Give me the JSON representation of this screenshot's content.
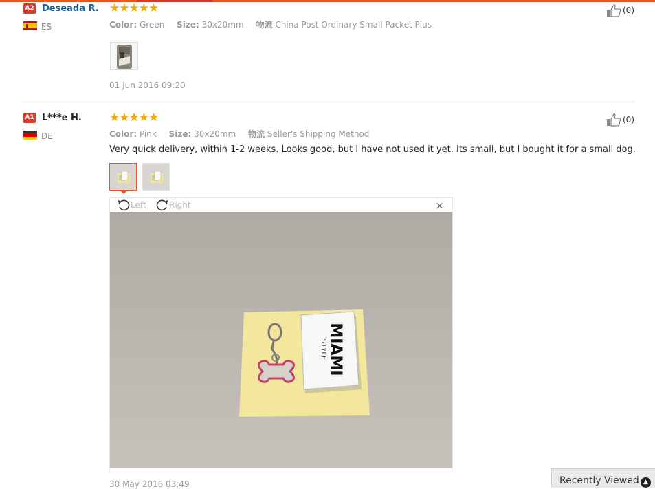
{
  "reviews": [
    {
      "rank_badge": "A2",
      "username": "Deseada R.",
      "country": "ES",
      "stars": "★★★★★",
      "color_label": "Color:",
      "color_value": "Green",
      "size_label": "Size:",
      "size_value": "30x20mm",
      "shipping_label": "物流",
      "shipping_value": "China Post Ordinary Small Packet Plus",
      "helpful_count": "(0)",
      "date": "01 Jun 2016 09:20"
    },
    {
      "rank_badge": "A1",
      "username": "L***e H.",
      "country": "DE",
      "stars": "★★★★★",
      "color_label": "Color:",
      "color_value": "Pink",
      "size_label": "Size:",
      "size_value": "30x20mm",
      "shipping_label": "物流",
      "shipping_value": "Seller's Shipping Method",
      "text": "Very quick delivery, within 1-2 weeks. Looks good, but I have not used it yet. Its small, but I bought it for a small dog.",
      "helpful_count": "(0)",
      "date": "30 May 2016 03:49"
    }
  ],
  "viewer": {
    "rotate_left_label": "Left",
    "rotate_right_label": "Right",
    "close_label": "×",
    "photo_box_text": "MIAMI",
    "photo_box_sub": "STYLE"
  },
  "recently_viewed": {
    "label": "Recently Viewed",
    "toggle_icon": "chevron-up-icon"
  }
}
